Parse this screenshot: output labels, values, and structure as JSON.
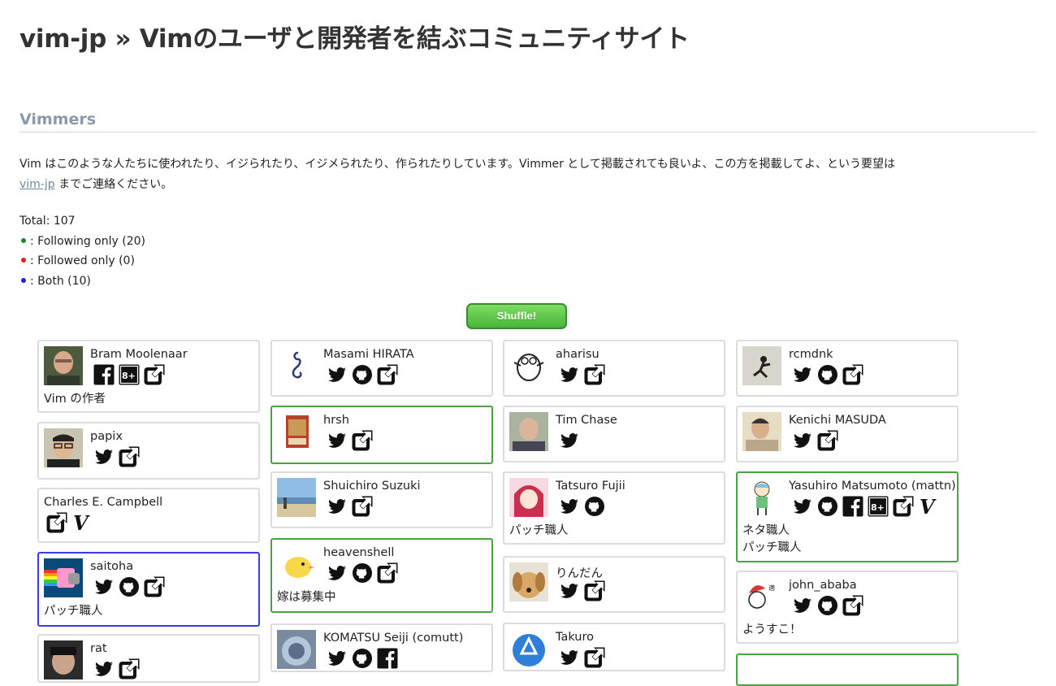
{
  "header": {
    "title": "vim-jp » Vimのユーザと開発者を結ぶコミュニティサイト"
  },
  "section": {
    "title": "Vimmers",
    "intro_text": "Vim はこのような人たちに使われたり、イジられたり、イジメられたり、作られたりしています。Vimmer として掲載されても良いよ、この方を掲載してよ、という要望は",
    "intro_link": "vim-jp",
    "intro_tail": " までご連絡ください。"
  },
  "stats": {
    "total": "Total: 107",
    "following": ": Following only (20)",
    "followed": ": Followed only (0)",
    "both": ": Both (10)",
    "colors": {
      "following": "#1a8a1a",
      "followed": "#e02020",
      "both": "#1f1fe0"
    }
  },
  "shuffle_label": "Shuffle!",
  "columns": [
    [
      {
        "name": "Bram Moolenaar",
        "icons": [
          "facebook-icon",
          "google-plus-icon",
          "external-link-icon"
        ],
        "desc": [
          "Vim の作者"
        ],
        "border": "normal",
        "avatar": "photo-man"
      },
      {
        "name": "papix",
        "icons": [
          "twitter-icon",
          "external-link-icon"
        ],
        "desc": [],
        "border": "normal",
        "avatar": "photo-man-glasses"
      },
      {
        "name": "Charles E. Campbell",
        "icons": [
          "external-link-icon",
          "vim-icon"
        ],
        "desc": [],
        "border": "normal",
        "avatar": "none"
      },
      {
        "name": "saitoha",
        "icons": [
          "twitter-icon",
          "github-icon",
          "external-link-icon"
        ],
        "desc": [
          "パッチ職人"
        ],
        "border": "blue",
        "avatar": "nyan-cat"
      },
      {
        "name": "rat",
        "icons": [
          "twitter-icon",
          "external-link-icon"
        ],
        "desc": [],
        "border": "normal",
        "avatar": "photo-dark"
      }
    ],
    [
      {
        "name": "Masami HIRATA",
        "icons": [
          "twitter-icon",
          "github-icon",
          "external-link-icon"
        ],
        "desc": [],
        "border": "normal",
        "avatar": "hook-drawing"
      },
      {
        "name": "hrsh",
        "icons": [
          "twitter-icon",
          "external-link-icon"
        ],
        "desc": [],
        "border": "green",
        "avatar": "card-art"
      },
      {
        "name": "Shuichiro Suzuki",
        "icons": [
          "twitter-icon",
          "external-link-icon"
        ],
        "desc": [],
        "border": "normal",
        "avatar": "photo-beach"
      },
      {
        "name": "heavenshell",
        "icons": [
          "twitter-icon",
          "github-icon",
          "external-link-icon"
        ],
        "desc": [
          "嫁は募集中"
        ],
        "border": "green",
        "avatar": "yellow-chick"
      },
      {
        "name": "KOMATSU Seiji (comutt)",
        "icons": [
          "twitter-icon",
          "github-icon",
          "facebook-icon"
        ],
        "desc": [],
        "border": "normal",
        "avatar": "photo-round"
      }
    ],
    [
      {
        "name": "aharisu",
        "icons": [
          "twitter-icon",
          "external-link-icon"
        ],
        "desc": [],
        "border": "normal",
        "avatar": "penguin-drawing"
      },
      {
        "name": "Tim Chase",
        "icons": [
          "twitter-icon"
        ],
        "desc": [],
        "border": "normal",
        "avatar": "photo-bald"
      },
      {
        "name": "Tatsuro Fujii",
        "icons": [
          "twitter-icon",
          "github-icon"
        ],
        "desc": [
          "パッチ職人"
        ],
        "border": "normal",
        "avatar": "anime-girl"
      },
      {
        "name": "りんだん",
        "icons": [
          "twitter-icon",
          "external-link-icon"
        ],
        "desc": [],
        "border": "normal",
        "avatar": "dog"
      },
      {
        "name": "Takuro",
        "icons": [
          "twitter-icon",
          "external-link-icon"
        ],
        "desc": [],
        "border": "normal",
        "avatar": "app-store"
      }
    ],
    [
      {
        "name": "rcmdnk",
        "icons": [
          "twitter-icon",
          "github-icon",
          "external-link-icon"
        ],
        "desc": [],
        "border": "normal",
        "avatar": "stick-figure"
      },
      {
        "name": "Kenichi MASUDA",
        "icons": [
          "twitter-icon",
          "external-link-icon"
        ],
        "desc": [],
        "border": "normal",
        "avatar": "photo-man-light"
      },
      {
        "name": "Yasuhiro Matsumoto (mattn)",
        "icons": [
          "twitter-icon",
          "github-icon",
          "facebook-icon",
          "google-plus-icon",
          "external-link-icon",
          "vim-icon"
        ],
        "desc": [
          "ネタ職人",
          "パッチ職人"
        ],
        "border": "green",
        "avatar": "boy-drawing"
      },
      {
        "name": "john_ababa",
        "icons": [
          "twitter-icon",
          "github-icon",
          "external-link-icon"
        ],
        "desc": [
          "ようすこ！"
        ],
        "border": "normal",
        "avatar": "santa-drawing"
      },
      {
        "name": "",
        "icons": [],
        "desc": [],
        "border": "green",
        "avatar": "none"
      }
    ]
  ]
}
